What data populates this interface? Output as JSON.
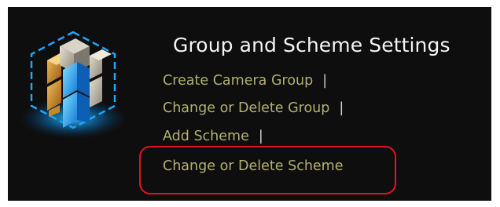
{
  "header": {
    "title": "Group and Scheme Settings"
  },
  "logo": {
    "icon": "camera-group-cube-logo"
  },
  "links": [
    {
      "label": "Create Camera Group",
      "separator": "|"
    },
    {
      "label": "Change or Delete Group",
      "separator": "|"
    },
    {
      "label": "Add Scheme",
      "separator": "|"
    },
    {
      "label": "Change or Delete Scheme",
      "separator": ""
    }
  ],
  "colors": {
    "panel_background": "#0e0e0e",
    "title": "#f4f4f4",
    "link": "#b3b070",
    "highlight_outline": "#e4121e"
  }
}
